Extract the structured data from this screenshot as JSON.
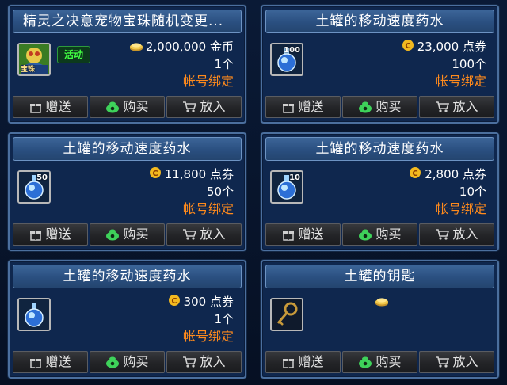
{
  "colors": {
    "accent": "#ff8a1c",
    "title_bg": "#2a4f80",
    "panel_bg": "#0f274e",
    "button_bg": "#232427",
    "badge_green": "#42ff42"
  },
  "items": [
    {
      "title": "精灵之决意宠物宝珠随机变更...",
      "badge": "活动",
      "icon": "pet-orb-icon",
      "currency_icon": "gold-coin-icon",
      "price": "2,000,000",
      "currency": "金币",
      "quantity": "1个",
      "bind": "帐号绑定",
      "icon_level": "宝珠",
      "buttons": {
        "gift": "赠送",
        "buy": "购买",
        "cart": "放入"
      }
    },
    {
      "title": "土罐的移动速度药水",
      "icon": "potion-icon",
      "icon_level": "100",
      "currency_icon": "point-coupon-icon",
      "price": "23,000",
      "currency": "点券",
      "quantity": "100个",
      "bind": "帐号绑定",
      "buttons": {
        "gift": "赠送",
        "buy": "购买",
        "cart": "放入"
      }
    },
    {
      "title": "土罐的移动速度药水",
      "icon": "potion-icon",
      "icon_level": "50",
      "currency_icon": "point-coupon-icon",
      "price": "11,800",
      "currency": "点券",
      "quantity": "50个",
      "bind": "帐号绑定",
      "buttons": {
        "gift": "赠送",
        "buy": "购买",
        "cart": "放入"
      }
    },
    {
      "title": "土罐的移动速度药水",
      "icon": "potion-icon",
      "icon_level": "10",
      "currency_icon": "point-coupon-icon",
      "price": "2,800",
      "currency": "点券",
      "quantity": "10个",
      "bind": "帐号绑定",
      "buttons": {
        "gift": "赠送",
        "buy": "购买",
        "cart": "放入"
      }
    },
    {
      "title": "土罐的移动速度药水",
      "icon": "potion-icon",
      "currency_icon": "point-coupon-icon",
      "price": "300",
      "currency": "点券",
      "quantity": "1个",
      "bind": "帐号绑定",
      "buttons": {
        "gift": "赠送",
        "buy": "购买",
        "cart": "放入"
      }
    },
    {
      "title": "土罐的钥匙",
      "icon": "key-icon",
      "currency_icon": "gold-coin-icon",
      "buttons": {
        "gift": "赠送",
        "buy": "购买",
        "cart": "放入"
      }
    }
  ]
}
